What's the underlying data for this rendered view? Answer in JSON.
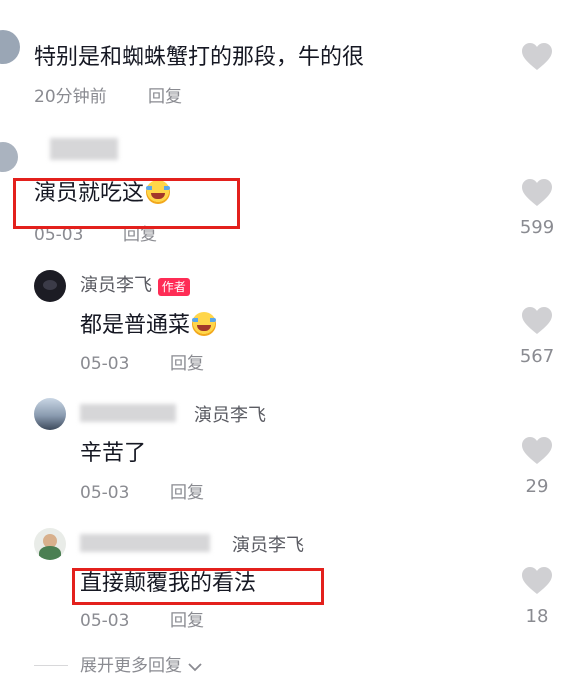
{
  "comments": [
    {
      "text": "特别是和蜘蛛蟹打的那段，牛的很",
      "time": "20分钟前",
      "reply": "回复",
      "likes": ""
    },
    {
      "text": "演员就吃这",
      "time": "05-03",
      "reply": "回复",
      "likes": "599"
    }
  ],
  "replies": [
    {
      "author": "演员李飞",
      "author_badge": "作者",
      "text": "都是普通菜",
      "time": "05-03",
      "reply": "回复",
      "likes": "567"
    },
    {
      "reply_to": "演员李飞",
      "text": "辛苦了",
      "time": "05-03",
      "reply": "回复",
      "likes": "29"
    },
    {
      "reply_to": "演员李飞",
      "text": "直接颠覆我的看法",
      "time": "05-03",
      "reply": "回复",
      "likes": "18"
    }
  ],
  "expand_more": "展开更多回复",
  "colors": {
    "highlight_box": "#e3201c",
    "author_badge_bg": "#fe2c55",
    "meta_text": "#8a8b91"
  },
  "icons": {
    "like": "heart-icon",
    "expand": "chevron-down-icon",
    "emoji": "laughing-tears-emoji-icon"
  }
}
